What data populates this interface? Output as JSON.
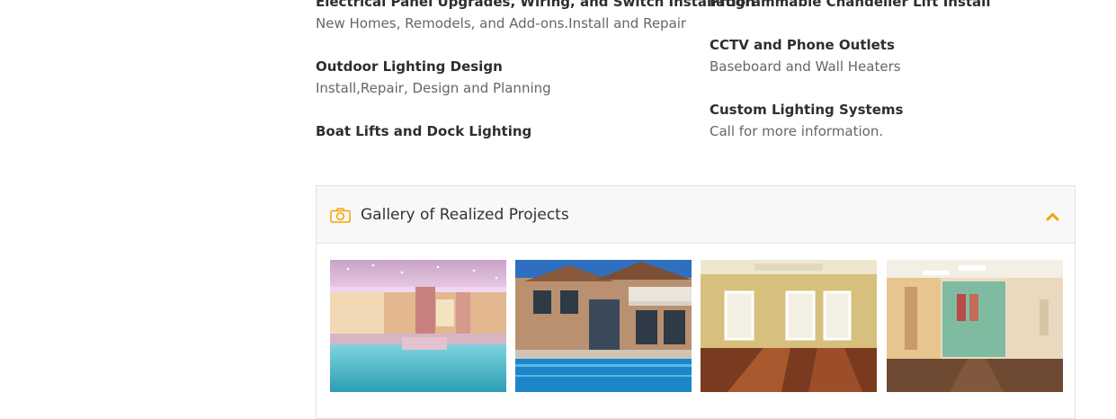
{
  "services": {
    "left": [
      {
        "title": "Electrical Panel Upgrades, Wiring, and Switch Installation",
        "desc": "New Homes, Remodels, and Add-ons.Install and Repair"
      },
      {
        "title": "Outdoor Lighting Design",
        "desc": "Install,Repair, Design and Planning"
      },
      {
        "title": "Boat Lifts and Dock Lighting",
        "desc": ""
      }
    ],
    "right": [
      {
        "title": "Programmable Chandelier Lift Install",
        "desc": ""
      },
      {
        "title": "CCTV and Phone Outlets",
        "desc": "Baseboard and Wall Heaters"
      },
      {
        "title": "Custom Lighting Systems",
        "desc": "Call for more information."
      }
    ]
  },
  "gallery": {
    "title": "Gallery of Realized Projects",
    "icon": "camera-icon",
    "toggle_icon": "chevron-up-icon",
    "accent_color": "#f0a500",
    "images": [
      {
        "subject": "indoor-pool-spa"
      },
      {
        "subject": "villa-with-pool"
      },
      {
        "subject": "empty-room-wood-floor"
      },
      {
        "subject": "office-hallway"
      }
    ]
  }
}
